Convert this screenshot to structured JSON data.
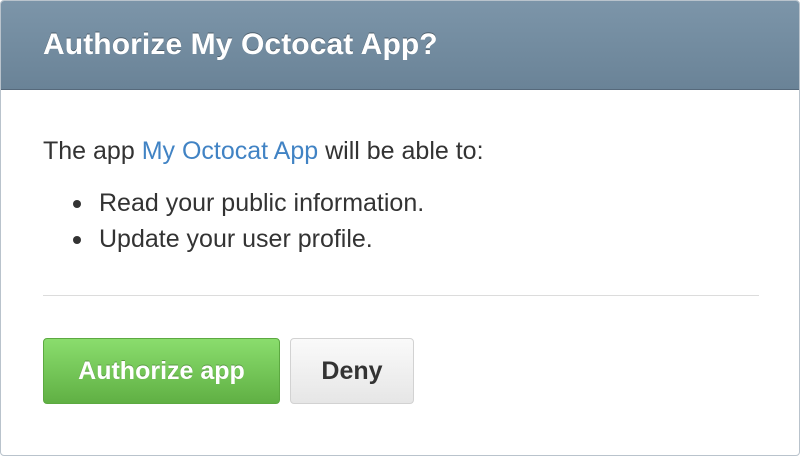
{
  "dialog": {
    "title": "Authorize My Octocat App?",
    "intro_prefix": "The app ",
    "app_name": "My Octocat App",
    "intro_suffix": " will be able to:",
    "permissions": [
      "Read your public information.",
      "Update your user profile."
    ],
    "authorize_label": "Authorize app",
    "deny_label": "Deny"
  },
  "colors": {
    "header": "#6f889c",
    "link": "#4183c4",
    "primary_button": "#6cc644",
    "text": "#333333"
  }
}
